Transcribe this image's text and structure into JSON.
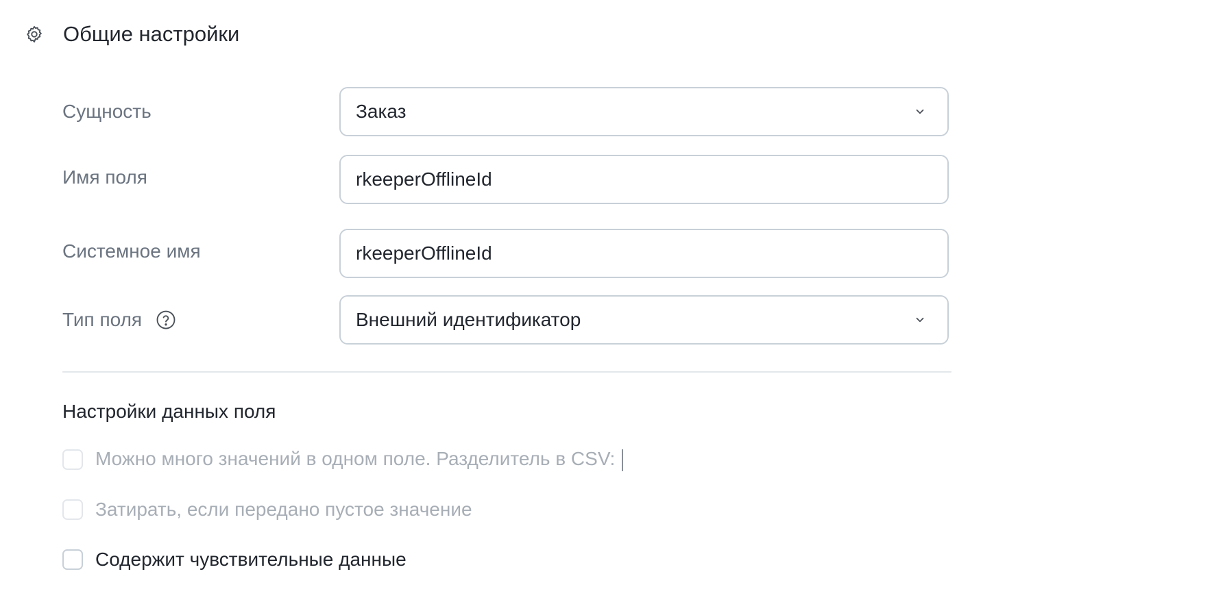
{
  "section": {
    "title": "Общие настройки",
    "icon": "gear-icon"
  },
  "form": {
    "entity": {
      "label": "Сущность",
      "value": "Заказ"
    },
    "field_name": {
      "label": "Имя поля",
      "value": "rkeeperOfflineId"
    },
    "system_name": {
      "label": "Системное имя",
      "value": "rkeeperOfflineId"
    },
    "field_type": {
      "label": "Тип поля",
      "value": "Внешний идентификатор",
      "help_icon": "question-circle-icon"
    }
  },
  "data_settings": {
    "heading": "Настройки данных поля",
    "options": [
      {
        "label": "Можно много значений в одном поле. Разделитель в CSV:",
        "checked": false,
        "disabled": true
      },
      {
        "label": "Затирать, если передано пустое значение",
        "checked": false,
        "disabled": true
      },
      {
        "label": "Содержит чувствительные данные",
        "checked": false,
        "disabled": false
      }
    ]
  },
  "colors": {
    "border": "#c8d0d8",
    "label": "#6b7480",
    "text": "#22262e",
    "disabled_text": "#a8aeb6"
  }
}
